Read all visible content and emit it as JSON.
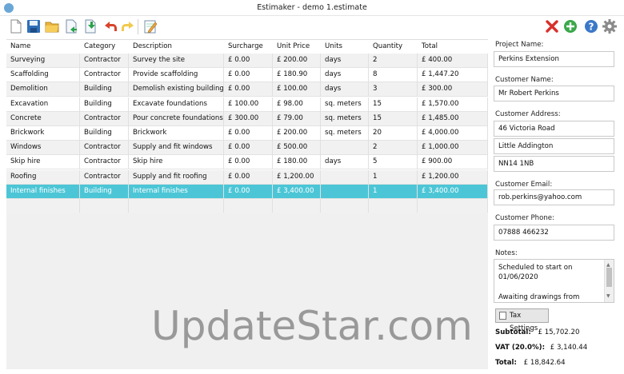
{
  "window": {
    "title": "Estimaker - demo 1.estimate"
  },
  "toolbar": {
    "icons": [
      "new-file-icon",
      "save-icon",
      "open-folder-icon",
      "export-icon",
      "import-icon",
      "undo-icon",
      "redo-icon",
      "edit-notes-icon"
    ],
    "right_icons": [
      "delete-icon",
      "add-icon",
      "help-icon",
      "settings-icon"
    ]
  },
  "table": {
    "columns": [
      "Name",
      "Category",
      "Description",
      "Surcharge",
      "Unit Price",
      "Units",
      "Quantity",
      "Total"
    ],
    "rows": [
      [
        "Surveying",
        "Contractor",
        "Survey the site",
        "£ 0.00",
        "£ 200.00",
        "days",
        "2",
        "£ 400.00"
      ],
      [
        "Scaffolding",
        "Contractor",
        "Provide scaffolding",
        "£ 0.00",
        "£ 180.90",
        "days",
        "8",
        "£ 1,447.20"
      ],
      [
        "Demolition",
        "Building",
        "Demolish existing building",
        "£ 0.00",
        "£ 100.00",
        "days",
        "3",
        "£ 300.00"
      ],
      [
        "Excavation",
        "Building",
        "Excavate foundations",
        "£ 100.00",
        "£ 98.00",
        "sq. meters",
        "15",
        "£ 1,570.00"
      ],
      [
        "Concrete",
        "Contractor",
        "Pour concrete foundations",
        "£ 300.00",
        "£ 79.00",
        "sq. meters",
        "15",
        "£ 1,485.00"
      ],
      [
        "Brickwork",
        "Building",
        "Brickwork",
        "£ 0.00",
        "£ 200.00",
        "sq. meters",
        "20",
        "£ 4,000.00"
      ],
      [
        "Windows",
        "Contractor",
        "Supply and fit windows",
        "£ 0.00",
        "£ 500.00",
        "",
        "2",
        "£ 1,000.00"
      ],
      [
        "Skip hire",
        "Contractor",
        "Skip hire",
        "£ 0.00",
        "£ 180.00",
        "days",
        "5",
        "£ 900.00"
      ],
      [
        "Roofing",
        "Contractor",
        "Supply and fit roofing",
        "£ 0.00",
        "£ 1,200.00",
        "",
        "1",
        "£ 1,200.00"
      ],
      [
        "Internal finishes",
        "Building",
        "Internal finishes",
        "£ 0.00",
        "£ 3,400.00",
        "",
        "1",
        "£ 3,400.00"
      ]
    ],
    "selected_row": 9
  },
  "project": {
    "name_label": "Project Name:",
    "name": "Perkins Extension",
    "customer_label": "Customer Name:",
    "customer": "Mr Robert Perkins",
    "address_label": "Customer Address:",
    "address1": "46 Victoria Road",
    "address2": "Little Addington",
    "address3": "NN14 1NB",
    "email_label": "Customer Email:",
    "email": "rob.perkins@yahoo.com",
    "phone_label": "Customer Phone:",
    "phone": "07888 466232",
    "notes_label": "Notes:",
    "notes_lines": [
      "Scheduled to start on",
      "01/06/2020",
      "",
      "Awaiting drawings from"
    ]
  },
  "tax_button": "Tax Settings",
  "totals": {
    "subtotal_label": "Subtotal:",
    "subtotal": "£ 15,702.20",
    "vat_label": "VAT (20.0%):",
    "vat": "£ 3,140.44",
    "total_label": "Total:",
    "total": "£ 18,842.64"
  },
  "watermark": "UpdateStar.com"
}
